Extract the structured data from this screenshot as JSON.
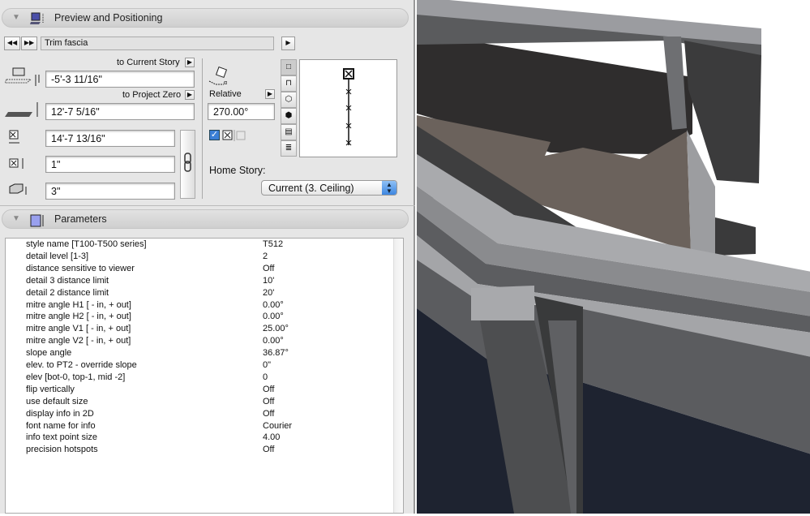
{
  "preview": {
    "title": "Preview and Positioning",
    "object_name": "Trim fascia",
    "to_current_story": "to Current Story",
    "elev_current": "-5'-3 11/16\"",
    "to_project_zero": "to Project Zero",
    "elev_zero": "12'-7 5/16\"",
    "length": "14'-7 13/16\"",
    "height": "1\"",
    "depth": "3\"",
    "angle_mode": "Relative",
    "angle": "270.00°",
    "home_story_label": "Home Story:",
    "home_story": "Current (3. Ceiling)",
    "checkbox_checked": true
  },
  "parameters": {
    "title": "Parameters",
    "rows": [
      {
        "name": "style name [T100-T500 series]",
        "value": "T512"
      },
      {
        "name": "detail level [1-3]",
        "value": "2"
      },
      {
        "name": "distance sensitive to viewer",
        "value": "Off"
      },
      {
        "name": "detail 3 distance limit",
        "value": "10'"
      },
      {
        "name": "detail 2 distance limit",
        "value": "20'"
      },
      {
        "name": "mitre angle H1 [ - in, + out]",
        "value": "0.00°"
      },
      {
        "name": "mitre angle H2 [ - in, + out]",
        "value": "0.00°"
      },
      {
        "name": "mitre angle V1 [ - in, + out]",
        "value": "25.00°"
      },
      {
        "name": "mitre angle V2 [ - in, + out]",
        "value": "0.00°"
      },
      {
        "name": "slope angle",
        "value": "36.87°"
      },
      {
        "name": "elev. to PT2 - override slope",
        "value": "0\""
      },
      {
        "name": "elev [bot-0, top-1, mid -2]",
        "value": "0"
      },
      {
        "name": "flip vertically",
        "value": "Off"
      },
      {
        "name": "use default size",
        "value": "Off"
      },
      {
        "name": "display info in 2D",
        "value": "Off"
      },
      {
        "name": "font name for info",
        "value": "Courier"
      },
      {
        "name": "info text point size",
        "value": "4.00"
      },
      {
        "name": "precision hotspots",
        "value": "Off"
      }
    ]
  }
}
